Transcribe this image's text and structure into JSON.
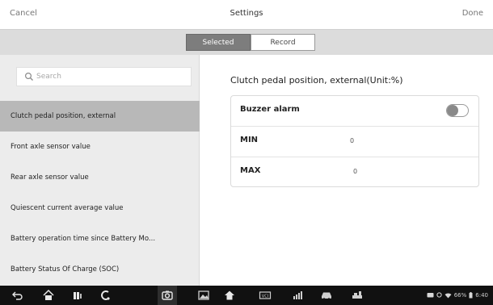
{
  "header": {
    "cancel_label": "Cancel",
    "title": "Settings",
    "done_label": "Done"
  },
  "tabs": [
    {
      "label": "Selected",
      "active": true
    },
    {
      "label": "Record",
      "active": false
    }
  ],
  "sidebar": {
    "search_placeholder": "Search",
    "items": [
      {
        "label": "Clutch pedal position, external",
        "active": true
      },
      {
        "label": "Front axle sensor value",
        "active": false
      },
      {
        "label": "Rear axle sensor value",
        "active": false
      },
      {
        "label": "Quiescent current average value",
        "active": false
      },
      {
        "label": "Battery operation time since Battery Mo...",
        "active": false
      },
      {
        "label": "Battery Status Of Charge (SOC)",
        "active": false
      }
    ]
  },
  "detail": {
    "title": "Clutch pedal position, external(Unit:%)",
    "buzzer_label": "Buzzer alarm",
    "buzzer_on": false,
    "min_label": "MIN",
    "min_value": "0",
    "max_label": "MAX",
    "max_value": "0"
  },
  "status_bar": {
    "battery": "66%",
    "time": "6:40"
  },
  "colors": {
    "selected_tab_bg": "#7d7d7d",
    "active_item_bg": "#b8b8b8",
    "sidebar_bg": "#ececec",
    "navbar_bg": "#111111"
  }
}
